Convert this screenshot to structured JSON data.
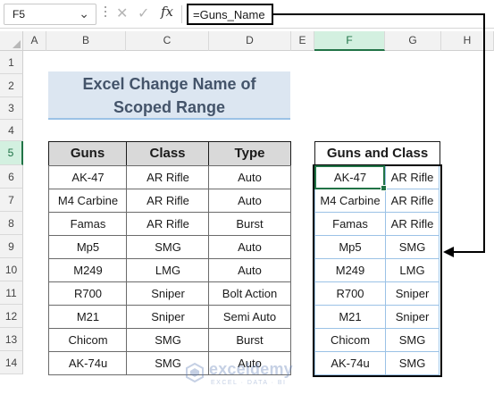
{
  "formula_bar": {
    "name_box": "F5",
    "name_box_arrow": "⌄",
    "cancel_glyph": "✕",
    "enter_glyph": "✓",
    "fx_label": "fx",
    "formula": "=Guns_Name"
  },
  "columns": [
    "A",
    "B",
    "C",
    "D",
    "E",
    "F",
    "G",
    "H"
  ],
  "rows": [
    "1",
    "2",
    "3",
    "4",
    "5",
    "6",
    "7",
    "8",
    "9",
    "10",
    "11",
    "12",
    "13",
    "14"
  ],
  "selected_column": "F",
  "selected_row": "5",
  "title": {
    "line1": "Excel Change Name of",
    "line2": "Scoped Range"
  },
  "main_table": {
    "headers": [
      "Guns",
      "Class",
      "Type"
    ],
    "rows": [
      [
        "AK-47",
        "AR Rifle",
        "Auto"
      ],
      [
        "M4 Carbine",
        "AR Rifle",
        "Auto"
      ],
      [
        "Famas",
        "AR Rifle",
        "Burst"
      ],
      [
        "Mp5",
        "SMG",
        "Auto"
      ],
      [
        "M249",
        "LMG",
        "Auto"
      ],
      [
        "R700",
        "Sniper",
        "Bolt Action"
      ],
      [
        "M21",
        "Sniper",
        "Semi Auto"
      ],
      [
        "Chicom",
        "SMG",
        "Burst"
      ],
      [
        "AK-74u",
        "SMG",
        "Auto"
      ]
    ]
  },
  "guns_class_table": {
    "header": "Guns and Class",
    "rows": [
      [
        "AK-47",
        "AR Rifle"
      ],
      [
        "M4 Carbine",
        "AR Rifle"
      ],
      [
        "Famas",
        "AR Rifle"
      ],
      [
        "Mp5",
        "SMG"
      ],
      [
        "M249",
        "LMG"
      ],
      [
        "R700",
        "Sniper"
      ],
      [
        "M21",
        "Sniper"
      ],
      [
        "Chicom",
        "SMG"
      ],
      [
        "AK-74u",
        "SMG"
      ]
    ]
  },
  "watermark": {
    "name": "exceldemy",
    "tagline": "EXCEL · DATA · BI"
  },
  "colors": {
    "title_fill": "#dce6f1",
    "title_text": "#44546a",
    "header_fill": "#d9d9d9",
    "selection": "#217346",
    "guns_class_border": "#9bc2e6"
  }
}
